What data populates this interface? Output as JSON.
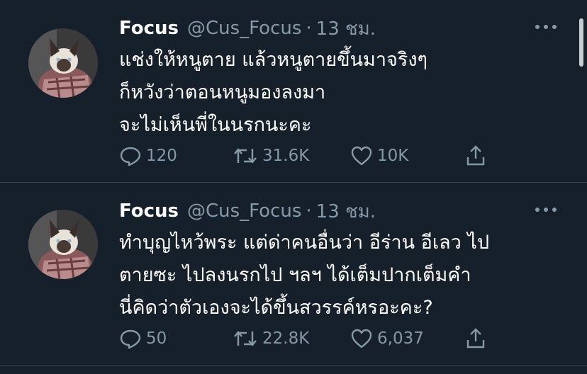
{
  "tweets": [
    {
      "display_name": "Focus",
      "handle": "@Cus_Focus",
      "separator": "·",
      "time": "13 ชม.",
      "text_lines": [
        "แช่งให้หนูตาย แล้วหนูตายขึ้นมาจริงๆ",
        "ก็หวังว่าตอนหนูมองลงมา",
        "จะไม่เห็นพี่ในนรกนะคะ"
      ],
      "replies": "120",
      "retweets": "31.6K",
      "likes": "10K"
    },
    {
      "display_name": "Focus",
      "handle": "@Cus_Focus",
      "separator": "·",
      "time": "13 ชม.",
      "text_lines": [
        "ทำบุญไหว้พระ แต่ด่าคนอื่นว่า อีร่าน อีเลว ไป",
        "ตายซะ ไปลงนรกไป ฯลฯ ได้เต็มปากเต็มคำ",
        "นี่คิดว่าตัวเองจะได้ขึ้นสวรรค์หรอะคะ?"
      ],
      "replies": "50",
      "retweets": "22.8K",
      "likes": "6,037"
    }
  ],
  "icons": {
    "avatar": "cat-avatar",
    "more": "more-horizontal-icon",
    "reply": "reply-icon",
    "retweet": "retweet-icon",
    "like": "like-icon",
    "share": "share-icon"
  },
  "colors": {
    "background": "#15202b",
    "divider": "#38444d",
    "primary_text": "#ffffff",
    "secondary_text": "#8899a6"
  }
}
